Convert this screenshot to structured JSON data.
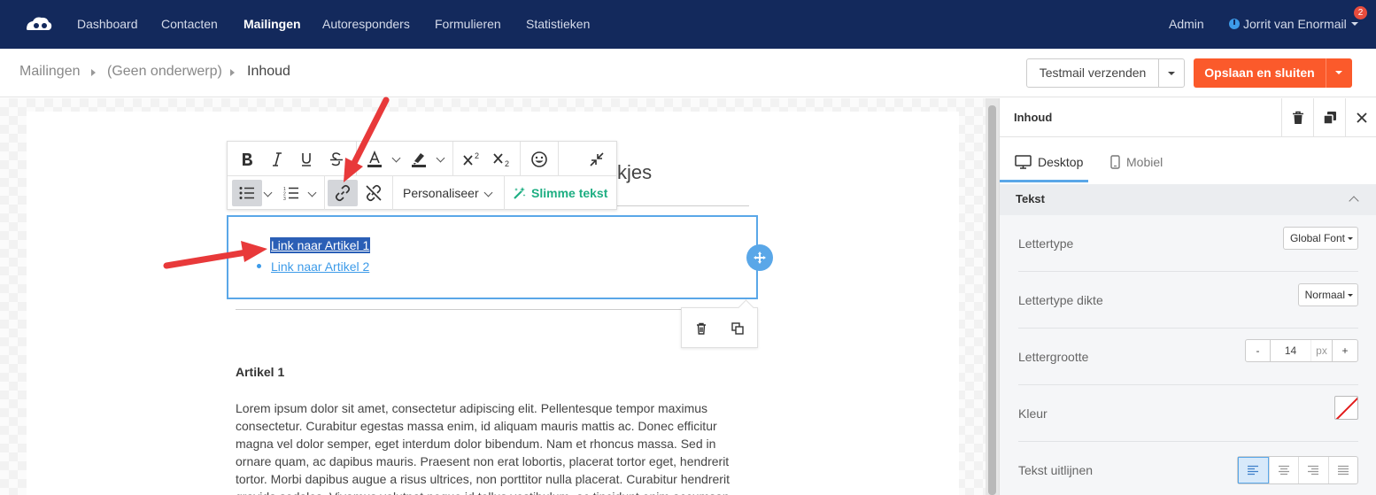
{
  "nav": {
    "items": [
      "Dashboard",
      "Contacten",
      "Mailingen",
      "Autoresponders",
      "Formulieren",
      "Statistieken"
    ],
    "active": "Mailingen",
    "admin": "Admin",
    "user": "Jorrit van Enormail",
    "badge": "2"
  },
  "breadcrumb": {
    "items": [
      "Mailingen",
      "(Geen onderwerp)",
      "Inhoud"
    ]
  },
  "actions": {
    "testmail": "Testmail verzenden",
    "save": "Opslaan en sluiten"
  },
  "editor": {
    "heading_partial": "kjes",
    "toolbar": {
      "personalise": "Personaliseer",
      "smart_text": "Slimme tekst"
    },
    "links": [
      "Link naar Artikel 1",
      "Link naar Artikel 2"
    ],
    "article_title": "Artikel 1",
    "article_body": "Lorem ipsum dolor sit amet, consectetur adipiscing elit. Pellentesque tempor maximus consectetur. Curabitur egestas massa enim, id aliquam mauris mattis ac. Donec efficitur magna vel dolor semper, eget interdum dolor bibendum. Nam et rhoncus massa. Sed in ornare quam, ac dapibus mauris. Praesent non erat lobortis, placerat tortor eget, hendrerit tortor. Morbi dapibus augue a risus ultrices, non porttitor nulla placerat. Curabitur hendrerit gravida sodales. Vivamus volutpat neque id tellus vestibulum, ac tincidunt enim accumsan"
  },
  "panel": {
    "title": "Inhoud",
    "tabs": [
      "Desktop",
      "Mobiel"
    ],
    "section": "Tekst",
    "props": {
      "font_label": "Lettertype",
      "font_value": "Global Font",
      "weight_label": "Lettertype dikte",
      "weight_value": "Normaal",
      "size_label": "Lettergrootte",
      "size_value": "14",
      "size_unit": "px",
      "minus": "-",
      "plus": "+",
      "color_label": "Kleur",
      "align_label": "Tekst uitlijnen"
    }
  },
  "colors": {
    "nav_bg": "#13295c",
    "accent_orange": "#fb5a2b",
    "accent_blue": "#5aa7e8",
    "smart_green": "#1dae82",
    "arrow_red": "#e8393a"
  }
}
